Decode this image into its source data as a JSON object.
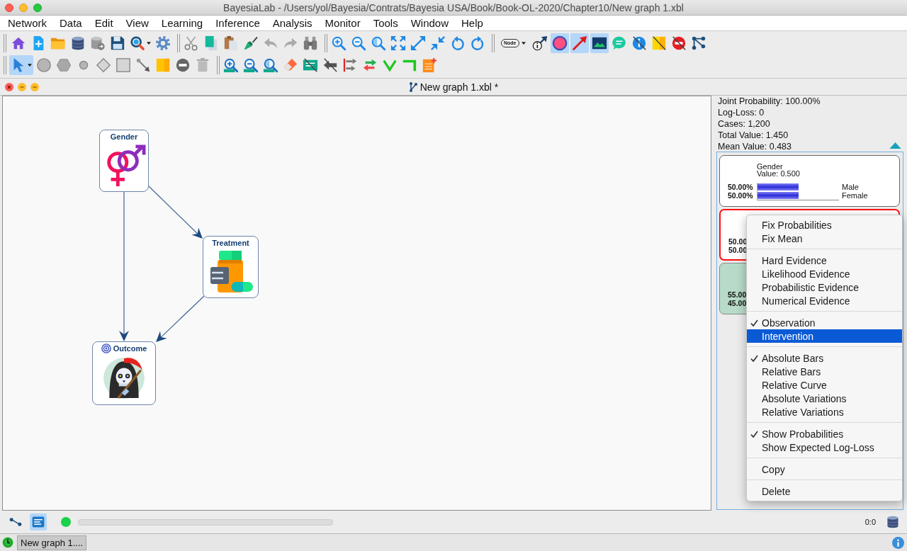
{
  "window": {
    "title": "BayesiaLab - /Users/yol/Bayesia/Contrats/Bayesia USA/Book/Book-OL-2020/Chapter10/New graph 1.xbl"
  },
  "menu_bar": [
    "Network",
    "Data",
    "Edit",
    "View",
    "Learning",
    "Inference",
    "Analysis",
    "Monitor",
    "Tools",
    "Window",
    "Help"
  ],
  "toolbars": [
    {
      "groups": [
        {
          "buttons": [
            {
              "on": false
            },
            {
              "on": false
            },
            {
              "on": false
            },
            {
              "on": false
            },
            {
              "on": false
            },
            {
              "on": false
            },
            {
              "on": false
            },
            {
              "on": false
            }
          ]
        },
        {
          "buttons": [
            {
              "on": false
            },
            {
              "on": false
            },
            {
              "on": false
            },
            {
              "on": false
            },
            {
              "on": false
            },
            {
              "on": false
            },
            {
              "on": false
            }
          ]
        },
        {
          "buttons": [
            {
              "on": false
            },
            {
              "on": false
            },
            {
              "on": false
            },
            {
              "on": false
            },
            {
              "on": false
            },
            {
              "on": false
            },
            {
              "on": false
            },
            {
              "on": false
            }
          ]
        },
        {
          "buttons": [
            {
              "label": "Node",
              "on": false
            },
            {
              "on": false
            },
            {
              "on": true
            },
            {
              "on": true
            },
            {
              "on": true
            },
            {
              "on": false
            },
            {
              "on": false
            },
            {
              "on": false
            },
            {
              "on": false
            },
            {
              "on": false
            }
          ]
        }
      ]
    },
    {
      "groups": [
        {
          "buttons": [
            {
              "on": true
            },
            {
              "on": false
            },
            {
              "on": false
            },
            {
              "on": false
            },
            {
              "on": false
            },
            {
              "on": false
            },
            {
              "on": false
            },
            {
              "on": false
            },
            {
              "on": false
            },
            {
              "on": false
            }
          ]
        },
        {
          "buttons": [
            {
              "on": false
            },
            {
              "on": false
            },
            {
              "on": false
            },
            {
              "on": false
            },
            {
              "on": false
            },
            {
              "on": false
            },
            {
              "on": false
            },
            {
              "on": false
            },
            {
              "on": false
            },
            {
              "on": false
            },
            {
              "on": false
            }
          ]
        }
      ]
    }
  ],
  "document": {
    "title": "New graph 1.xbl *"
  },
  "graph": {
    "nodes": [
      {
        "name": "Gender",
        "target": false
      },
      {
        "name": "Treatment",
        "target": false
      },
      {
        "name": "Outcome",
        "target": true
      }
    ]
  },
  "statistics": [
    "Joint Probability: 100.00%",
    "Log-Loss: 0",
    "Cases: 1,200",
    "Total Value: 1.450",
    "Mean Value: 0.483"
  ],
  "monitors": [
    {
      "name": "Gender",
      "value": "Value: 0.500",
      "selected": false,
      "target": false,
      "states": [
        {
          "percent": "50.00%",
          "level": 0.5,
          "label": "Male"
        },
        {
          "percent": "50.00%",
          "level": 0.5,
          "label": "Female"
        }
      ]
    },
    {
      "selected": true,
      "target": false,
      "states": [
        {
          "percent": "50.00"
        },
        {
          "percent": "50.00"
        }
      ]
    },
    {
      "selected": false,
      "target": true,
      "states": [
        {
          "percent": "55.00"
        },
        {
          "percent": "45.00"
        }
      ]
    }
  ],
  "context_menu": {
    "groups": [
      {
        "items": [
          {
            "label": "Fix Probabilities",
            "checked": false,
            "selected": false
          },
          {
            "label": "Fix Mean",
            "checked": false,
            "selected": false
          }
        ]
      },
      {
        "items": [
          {
            "label": "Hard Evidence",
            "checked": false,
            "selected": false
          },
          {
            "label": "Likelihood Evidence",
            "checked": false,
            "selected": false
          },
          {
            "label": "Probabilistic Evidence",
            "checked": false,
            "selected": false
          },
          {
            "label": "Numerical Evidence",
            "checked": false,
            "selected": false
          }
        ]
      },
      {
        "items": [
          {
            "label": "Observation",
            "checked": true,
            "selected": false
          },
          {
            "label": "Intervention",
            "checked": false,
            "selected": true
          }
        ]
      },
      {
        "items": [
          {
            "label": "Absolute Bars",
            "checked": true,
            "selected": false
          },
          {
            "label": "Relative Bars",
            "checked": false,
            "selected": false
          },
          {
            "label": "Relative Curve",
            "checked": false,
            "selected": false
          },
          {
            "label": "Absolute Variations",
            "checked": false,
            "selected": false
          },
          {
            "label": "Relative Variations",
            "checked": false,
            "selected": false
          }
        ]
      },
      {
        "items": [
          {
            "label": "Show Probabilities",
            "checked": true,
            "selected": false
          },
          {
            "label": "Show Expected Log-Loss",
            "checked": false,
            "selected": false
          }
        ]
      },
      {
        "items": [
          {
            "label": "Copy",
            "checked": false,
            "selected": false
          }
        ]
      },
      {
        "items": [
          {
            "label": "Delete",
            "checked": false,
            "selected": false
          }
        ]
      }
    ]
  },
  "status_bar": {
    "modes": [
      {
        "on": false
      },
      {
        "on": true
      }
    ],
    "counter": "0:0"
  },
  "taskbar": {
    "tabs": [
      {
        "label": "New graph 1...."
      }
    ]
  }
}
